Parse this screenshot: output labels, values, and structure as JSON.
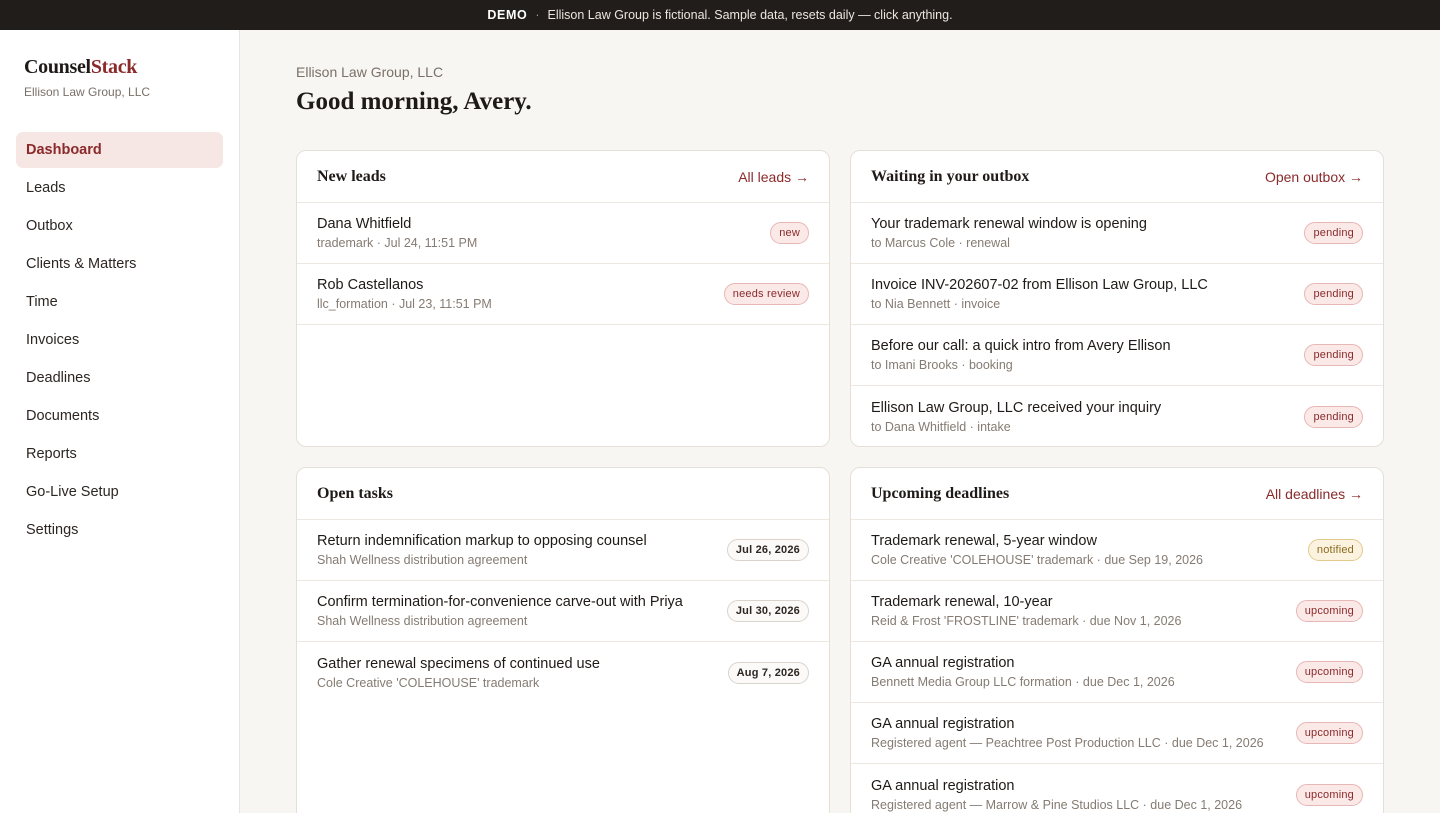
{
  "banner": {
    "tag": "DEMO",
    "separator": "·",
    "message": "Ellison Law Group is fictional. Sample data, resets daily — click anything."
  },
  "sidebar": {
    "brand_primary": "Counsel",
    "brand_accent": "Stack",
    "firm": "Ellison Law Group, LLC",
    "nav": [
      {
        "label": "Dashboard",
        "active": true
      },
      {
        "label": "Leads"
      },
      {
        "label": "Outbox"
      },
      {
        "label": "Clients & Matters"
      },
      {
        "label": "Time"
      },
      {
        "label": "Invoices"
      },
      {
        "label": "Deadlines"
      },
      {
        "label": "Documents"
      },
      {
        "label": "Reports"
      },
      {
        "label": "Go-Live Setup"
      },
      {
        "label": "Settings"
      }
    ]
  },
  "header": {
    "firm": "Ellison Law Group, LLC",
    "greeting": "Good morning, Avery."
  },
  "leads": {
    "title": "New leads",
    "link": "All leads →",
    "items": [
      {
        "name": "Dana Whitfield",
        "meta": "trademark · Jul 24, 11:51 PM",
        "badge": "new"
      },
      {
        "name": "Rob Castellanos",
        "meta": "llc_formation · Jul 23, 11:51 PM",
        "badge": "needs review"
      }
    ]
  },
  "outbox": {
    "title": "Waiting in your outbox",
    "link": "Open outbox →",
    "items": [
      {
        "subject": "Your trademark renewal window is opening",
        "meta": "to Marcus Cole · renewal",
        "badge": "pending"
      },
      {
        "subject": "Invoice INV-202607-02 from Ellison Law Group, LLC",
        "meta": "to Nia Bennett · invoice",
        "badge": "pending"
      },
      {
        "subject": "Before our call: a quick intro from Avery Ellison",
        "meta": "to Imani Brooks · booking",
        "badge": "pending"
      },
      {
        "subject": "Ellison Law Group, LLC received your inquiry",
        "meta": "to Dana Whitfield · intake",
        "badge": "pending"
      }
    ]
  },
  "tasks": {
    "title": "Open tasks",
    "items": [
      {
        "title": "Return indemnification markup to opposing counsel",
        "meta": "Shah Wellness distribution agreement",
        "date": "Jul 26, 2026"
      },
      {
        "title": "Confirm termination-for-convenience carve-out with Priya",
        "meta": "Shah Wellness distribution agreement",
        "date": "Jul 30, 2026"
      },
      {
        "title": "Gather renewal specimens of continued use",
        "meta": "Cole Creative 'COLEHOUSE' trademark",
        "date": "Aug 7, 2026"
      }
    ]
  },
  "deadlines": {
    "title": "Upcoming deadlines",
    "link": "All deadlines →",
    "items": [
      {
        "title": "Trademark renewal, 5-year window",
        "meta": "Cole Creative 'COLEHOUSE' trademark · due Sep 19, 2026",
        "badge": "notified"
      },
      {
        "title": "Trademark renewal, 10-year",
        "meta": "Reid & Frost 'FROSTLINE' trademark · due Nov 1, 2026",
        "badge": "upcoming"
      },
      {
        "title": "GA annual registration",
        "meta": "Bennett Media Group LLC formation · due Dec 1, 2026",
        "badge": "upcoming"
      },
      {
        "title": "GA annual registration",
        "meta": "Registered agent — Peachtree Post Production LLC · due Dec 1, 2026",
        "badge": "upcoming"
      },
      {
        "title": "GA annual registration",
        "meta": "Registered agent — Marrow & Pine Studios LLC · due Dec 1, 2026",
        "badge": "upcoming"
      }
    ]
  },
  "colors": {
    "accent": "#8a2a2b",
    "banner_bg": "#211d1a",
    "page_bg": "#f8f6f2",
    "active_nav_bg": "#f6e6e4",
    "badge_pending": "#fbe9e8",
    "badge_notified": "#fbf3df"
  }
}
